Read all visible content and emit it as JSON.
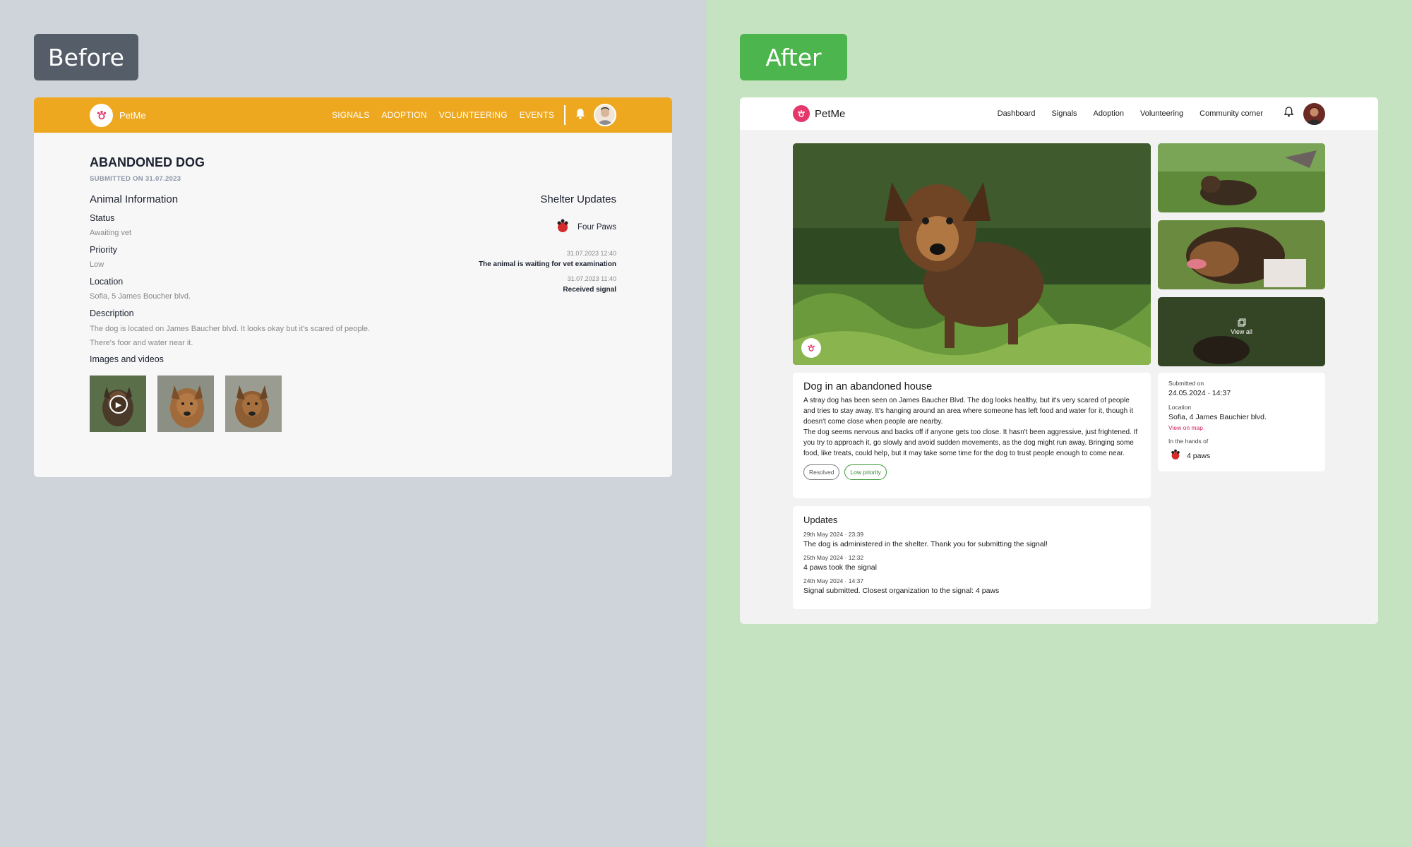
{
  "labels": {
    "before": "Before",
    "after": "After"
  },
  "colors": {
    "old_header": "#eea820",
    "accent_pink": "#e5386a",
    "resolved_border": "#7a7a7a",
    "low_priority_green": "#3b9a3b"
  },
  "before": {
    "brand": "PetMe",
    "nav": [
      "SIGNALS",
      "ADOPTION",
      "VOLUNTEERING",
      "EVENTS"
    ],
    "title": "ABANDONED DOG",
    "submitted": "SUBMITTED ON 31.07.2023",
    "animal_info_heading": "Animal Information",
    "fields": [
      {
        "label": "Status",
        "value": "Awaiting vet"
      },
      {
        "label": "Priority",
        "value": "Low"
      },
      {
        "label": "Location",
        "value": "Sofia, 5 James Boucher blvd."
      }
    ],
    "description_label": "Description",
    "description": "The dog is located on James Baucher blvd. It looks okay but it's scared of people. There's foor and water near it.",
    "media_label": "Images and videos",
    "shelter_heading": "Shelter Updates",
    "shelter_name": "Four Paws",
    "updates": [
      {
        "time": "31.07.2023 12:40",
        "text": "The animal is waiting for vet examination"
      },
      {
        "time": "31.07.2023 11:40",
        "text": "Received signal"
      }
    ]
  },
  "after": {
    "brand": "PetMe",
    "nav": [
      "Dashboard",
      "Signals",
      "Adoption",
      "Volunteering",
      "Community corner"
    ],
    "view_all": "View all",
    "title": "Dog in an abandoned house",
    "paragraph1": "A stray dog has been seen on James Baucher Blvd. The dog looks healthy, but it's very scared of people and tries to stay away. It's hanging around an area where someone has left food and water for it, though it doesn't come close when people are nearby.",
    "paragraph2": "The dog seems nervous and backs off if anyone gets too close. It hasn't been aggressive, just frightened. If you try to approach it, go slowly and avoid sudden movements, as the dog might run away. Bringing some food, like treats, could help, but it may take some time for the dog to trust people enough to come near.",
    "tags": {
      "status": "Resolved",
      "priority": "Low priority"
    },
    "updates_heading": "Updates",
    "updates": [
      {
        "time": "29th May 2024 · 23:39",
        "text": "The dog is administered in the shelter. Thank you for submitting the signal!"
      },
      {
        "time": "25th May 2024 · 12:32",
        "text": "4 paws took the signal"
      },
      {
        "time": "24th May 2024 · 14:37",
        "text": "Signal submitted. Closest organization to the signal: 4 paws"
      }
    ],
    "meta": {
      "submitted_label": "Submitted on",
      "submitted_value": "24.05.2024 · 14:37",
      "location_label": "Location",
      "location_value": "Sofia, 4 James Bauchier blvd.",
      "map_link": "View on map",
      "hands_label": "In the hands of",
      "hands_value": "4 paws"
    }
  }
}
